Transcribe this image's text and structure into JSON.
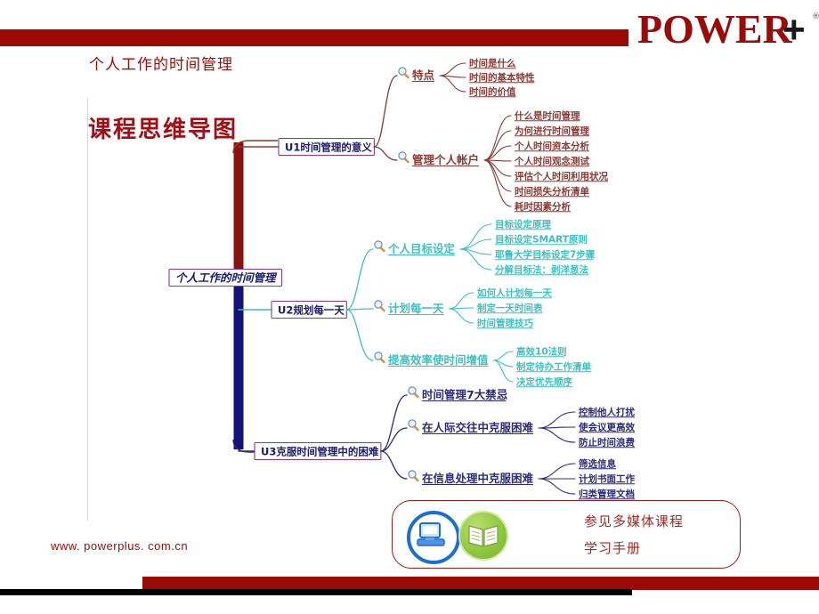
{
  "header": {
    "logo_text": "POWER",
    "logo_plus": "+",
    "logo_reg": "®",
    "slide_title": "个人工作的时间管理",
    "big_title": "课程思维导图",
    "bar_color": "#9c0a06"
  },
  "footer": {
    "site_url": "www. powerplus. com.cn",
    "bar_color": "#9c0a06"
  },
  "callout": {
    "line1": "参见多媒体课程",
    "line2": "学习手册",
    "icons": [
      "computer-icon",
      "book-icon"
    ],
    "border_color": "#9c1b1b",
    "text_color": "#a8261f"
  },
  "mindmap": {
    "root": "个人工作的时间管理",
    "colors": {
      "u1": "#8a3a33",
      "u2": "#3fbfbf",
      "u3": "#2b2b7a",
      "node_border": "#8a3a8a",
      "trunk_top": "#8b1010",
      "trunk_bottom": "#141478"
    },
    "units": [
      {
        "id": "u1",
        "label": "U1时间管理的意义",
        "color": "#8a3a33",
        "branches": [
          {
            "label": "特点",
            "icon": "magnifier-icon",
            "leaves": [
              "时间是什么",
              "时间的基本特性",
              "时间的价值"
            ]
          },
          {
            "label": "管理个人帐户",
            "icon": "magnifier-icon",
            "leaves": [
              "什么是时间管理",
              "为何进行时间管理",
              "个人时间资本分析",
              "个人时间观念测试",
              "评估个人时间利用状况",
              "时间损失分析清单",
              "耗时因素分析"
            ]
          }
        ]
      },
      {
        "id": "u2",
        "label": "U2规划每一天",
        "color": "#3fbfbf",
        "branches": [
          {
            "label": "个人目标设定",
            "icon": "magnifier-icon",
            "leaves": [
              "目标设定原理",
              "目标设定SMART原则",
              "耶鲁大学目标设定7步骤",
              "分解目标法：剥洋葱法"
            ]
          },
          {
            "label": "计划每一天",
            "icon": "magnifier-icon",
            "leaves": [
              "如何人计划每一天",
              "制定一天时间表",
              "时间管理技巧"
            ]
          },
          {
            "label": "提高效率使时间增值",
            "icon": "magnifier-icon",
            "leaves": [
              "高效10法则",
              "制定待办工作清单",
              "决定优先顺序"
            ]
          }
        ]
      },
      {
        "id": "u3",
        "label": "U3克服时间管理中的困难",
        "color": "#2b2b7a",
        "branches": [
          {
            "label": "时间管理7大禁忌",
            "icon": "magnifier-icon",
            "leaves": []
          },
          {
            "label": "在人际交往中克服困难",
            "icon": "magnifier-icon",
            "leaves": [
              "控制他人打扰",
              "使会议更高效",
              "防止时间浪费"
            ]
          },
          {
            "label": "在信息处理中克服困难",
            "icon": "magnifier-icon",
            "leaves": [
              "筛选信息",
              "计划书面工作",
              "归类管理文档"
            ]
          }
        ]
      }
    ]
  }
}
